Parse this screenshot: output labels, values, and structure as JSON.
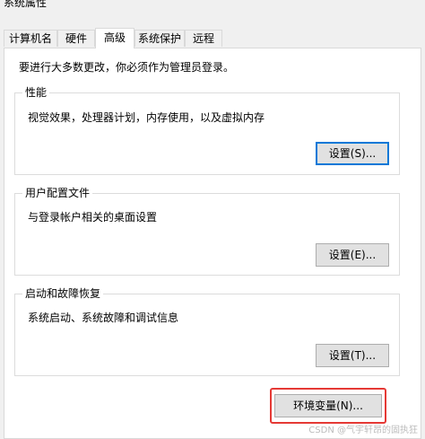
{
  "window": {
    "title": "系统属性"
  },
  "tabs": [
    {
      "label": "计算机名",
      "active": false
    },
    {
      "label": "硬件",
      "active": false
    },
    {
      "label": "高级",
      "active": true
    },
    {
      "label": "系统保护",
      "active": false
    },
    {
      "label": "远程",
      "active": false
    }
  ],
  "admin_note": "要进行大多数更改，你必须作为管理员登录。",
  "groups": {
    "performance": {
      "title": "性能",
      "description": "视觉效果，处理器计划，内存使用，以及虚拟内存",
      "button": "设置(S)..."
    },
    "user_profiles": {
      "title": "用户配置文件",
      "description": "与登录帐户相关的桌面设置",
      "button": "设置(E)..."
    },
    "startup_recovery": {
      "title": "启动和故障恢复",
      "description": "系统启动、系统故障和调试信息",
      "button": "设置(T)..."
    }
  },
  "env_button": {
    "label": "环境变量(N)..."
  },
  "watermark": "CSDN @气宇轩昂的固执狂",
  "colors": {
    "highlight": "#e53935",
    "focus": "#0078d7"
  }
}
